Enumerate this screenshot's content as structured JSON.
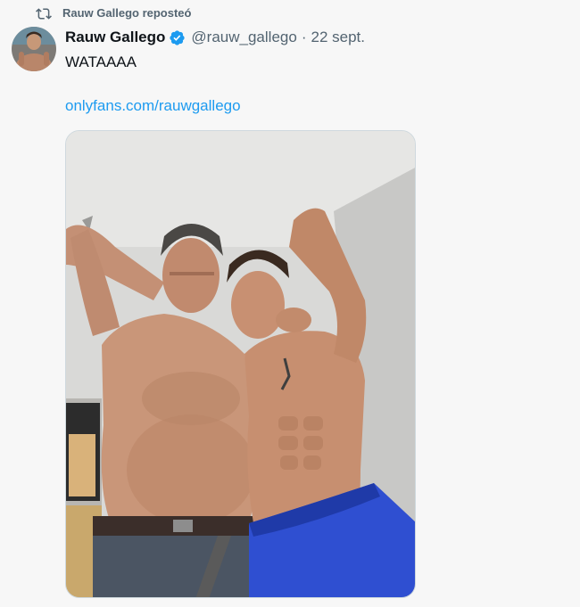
{
  "repost": {
    "icon": "repost-icon",
    "label": "Rauw Gallego reposteó"
  },
  "author": {
    "avatar_icon": "avatar",
    "display_name": "Rauw Gallego",
    "verified_icon": "verified-badge-icon",
    "handle": "@rauw_gallego",
    "separator": "·",
    "date": "22 sept."
  },
  "tweet": {
    "text": "WATAAAA",
    "link_text": "onlyfans.com/rauwgallego"
  },
  "media": {
    "type": "photo"
  },
  "colors": {
    "text_primary": "#0f1419",
    "text_secondary": "#536471",
    "link": "#1d9bf0",
    "verified": "#1d9bf0",
    "background": "#f7f7f7"
  }
}
